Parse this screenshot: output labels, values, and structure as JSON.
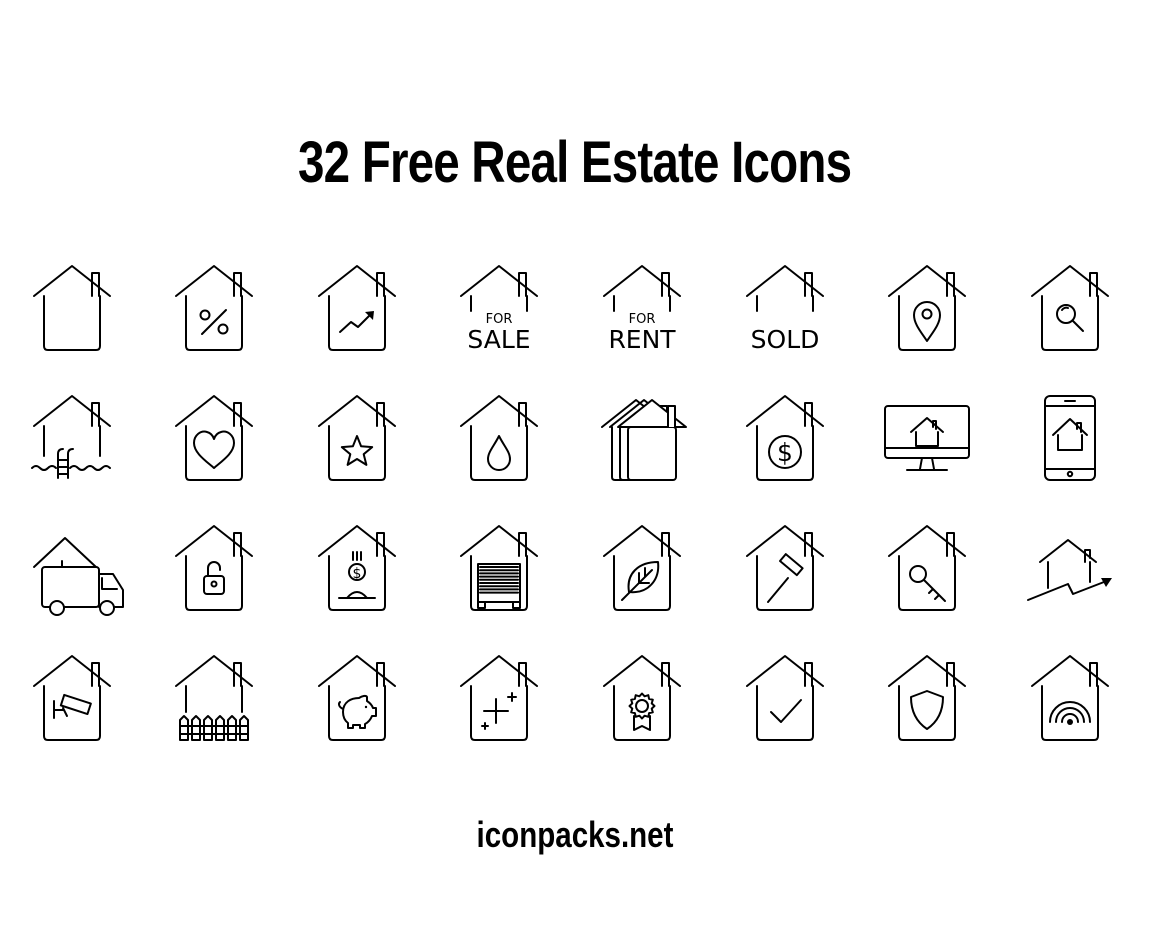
{
  "title": "32 Free Real Estate Icons",
  "footer": "iconpacks.net",
  "icons": [
    {
      "name": "house-icon"
    },
    {
      "name": "house-percent-icon"
    },
    {
      "name": "house-trend-up-icon"
    },
    {
      "name": "house-for-sale-icon",
      "line1": "FOR",
      "line2": "SALE"
    },
    {
      "name": "house-for-rent-icon",
      "line1": "FOR",
      "line2": "RENT"
    },
    {
      "name": "house-sold-icon",
      "line2": "SOLD"
    },
    {
      "name": "house-location-pin-icon"
    },
    {
      "name": "house-search-icon"
    },
    {
      "name": "house-pool-icon"
    },
    {
      "name": "house-heart-icon"
    },
    {
      "name": "house-star-icon"
    },
    {
      "name": "house-water-drop-icon"
    },
    {
      "name": "multiple-houses-icon"
    },
    {
      "name": "house-dollar-icon",
      "symbol": "$"
    },
    {
      "name": "desktop-house-icon"
    },
    {
      "name": "mobile-house-icon"
    },
    {
      "name": "moving-truck-house-icon"
    },
    {
      "name": "house-unlocked-padlock-icon"
    },
    {
      "name": "house-coin-deposit-icon",
      "symbol": "$"
    },
    {
      "name": "house-garage-icon"
    },
    {
      "name": "house-leaf-icon"
    },
    {
      "name": "house-auction-gavel-icon"
    },
    {
      "name": "house-key-icon"
    },
    {
      "name": "house-price-rising-icon"
    },
    {
      "name": "house-security-camera-icon"
    },
    {
      "name": "house-fence-icon"
    },
    {
      "name": "house-piggy-bank-icon"
    },
    {
      "name": "house-sparkle-new-icon"
    },
    {
      "name": "house-award-badge-icon"
    },
    {
      "name": "house-checkmark-icon"
    },
    {
      "name": "house-shield-icon"
    },
    {
      "name": "house-wifi-smart-icon"
    }
  ]
}
